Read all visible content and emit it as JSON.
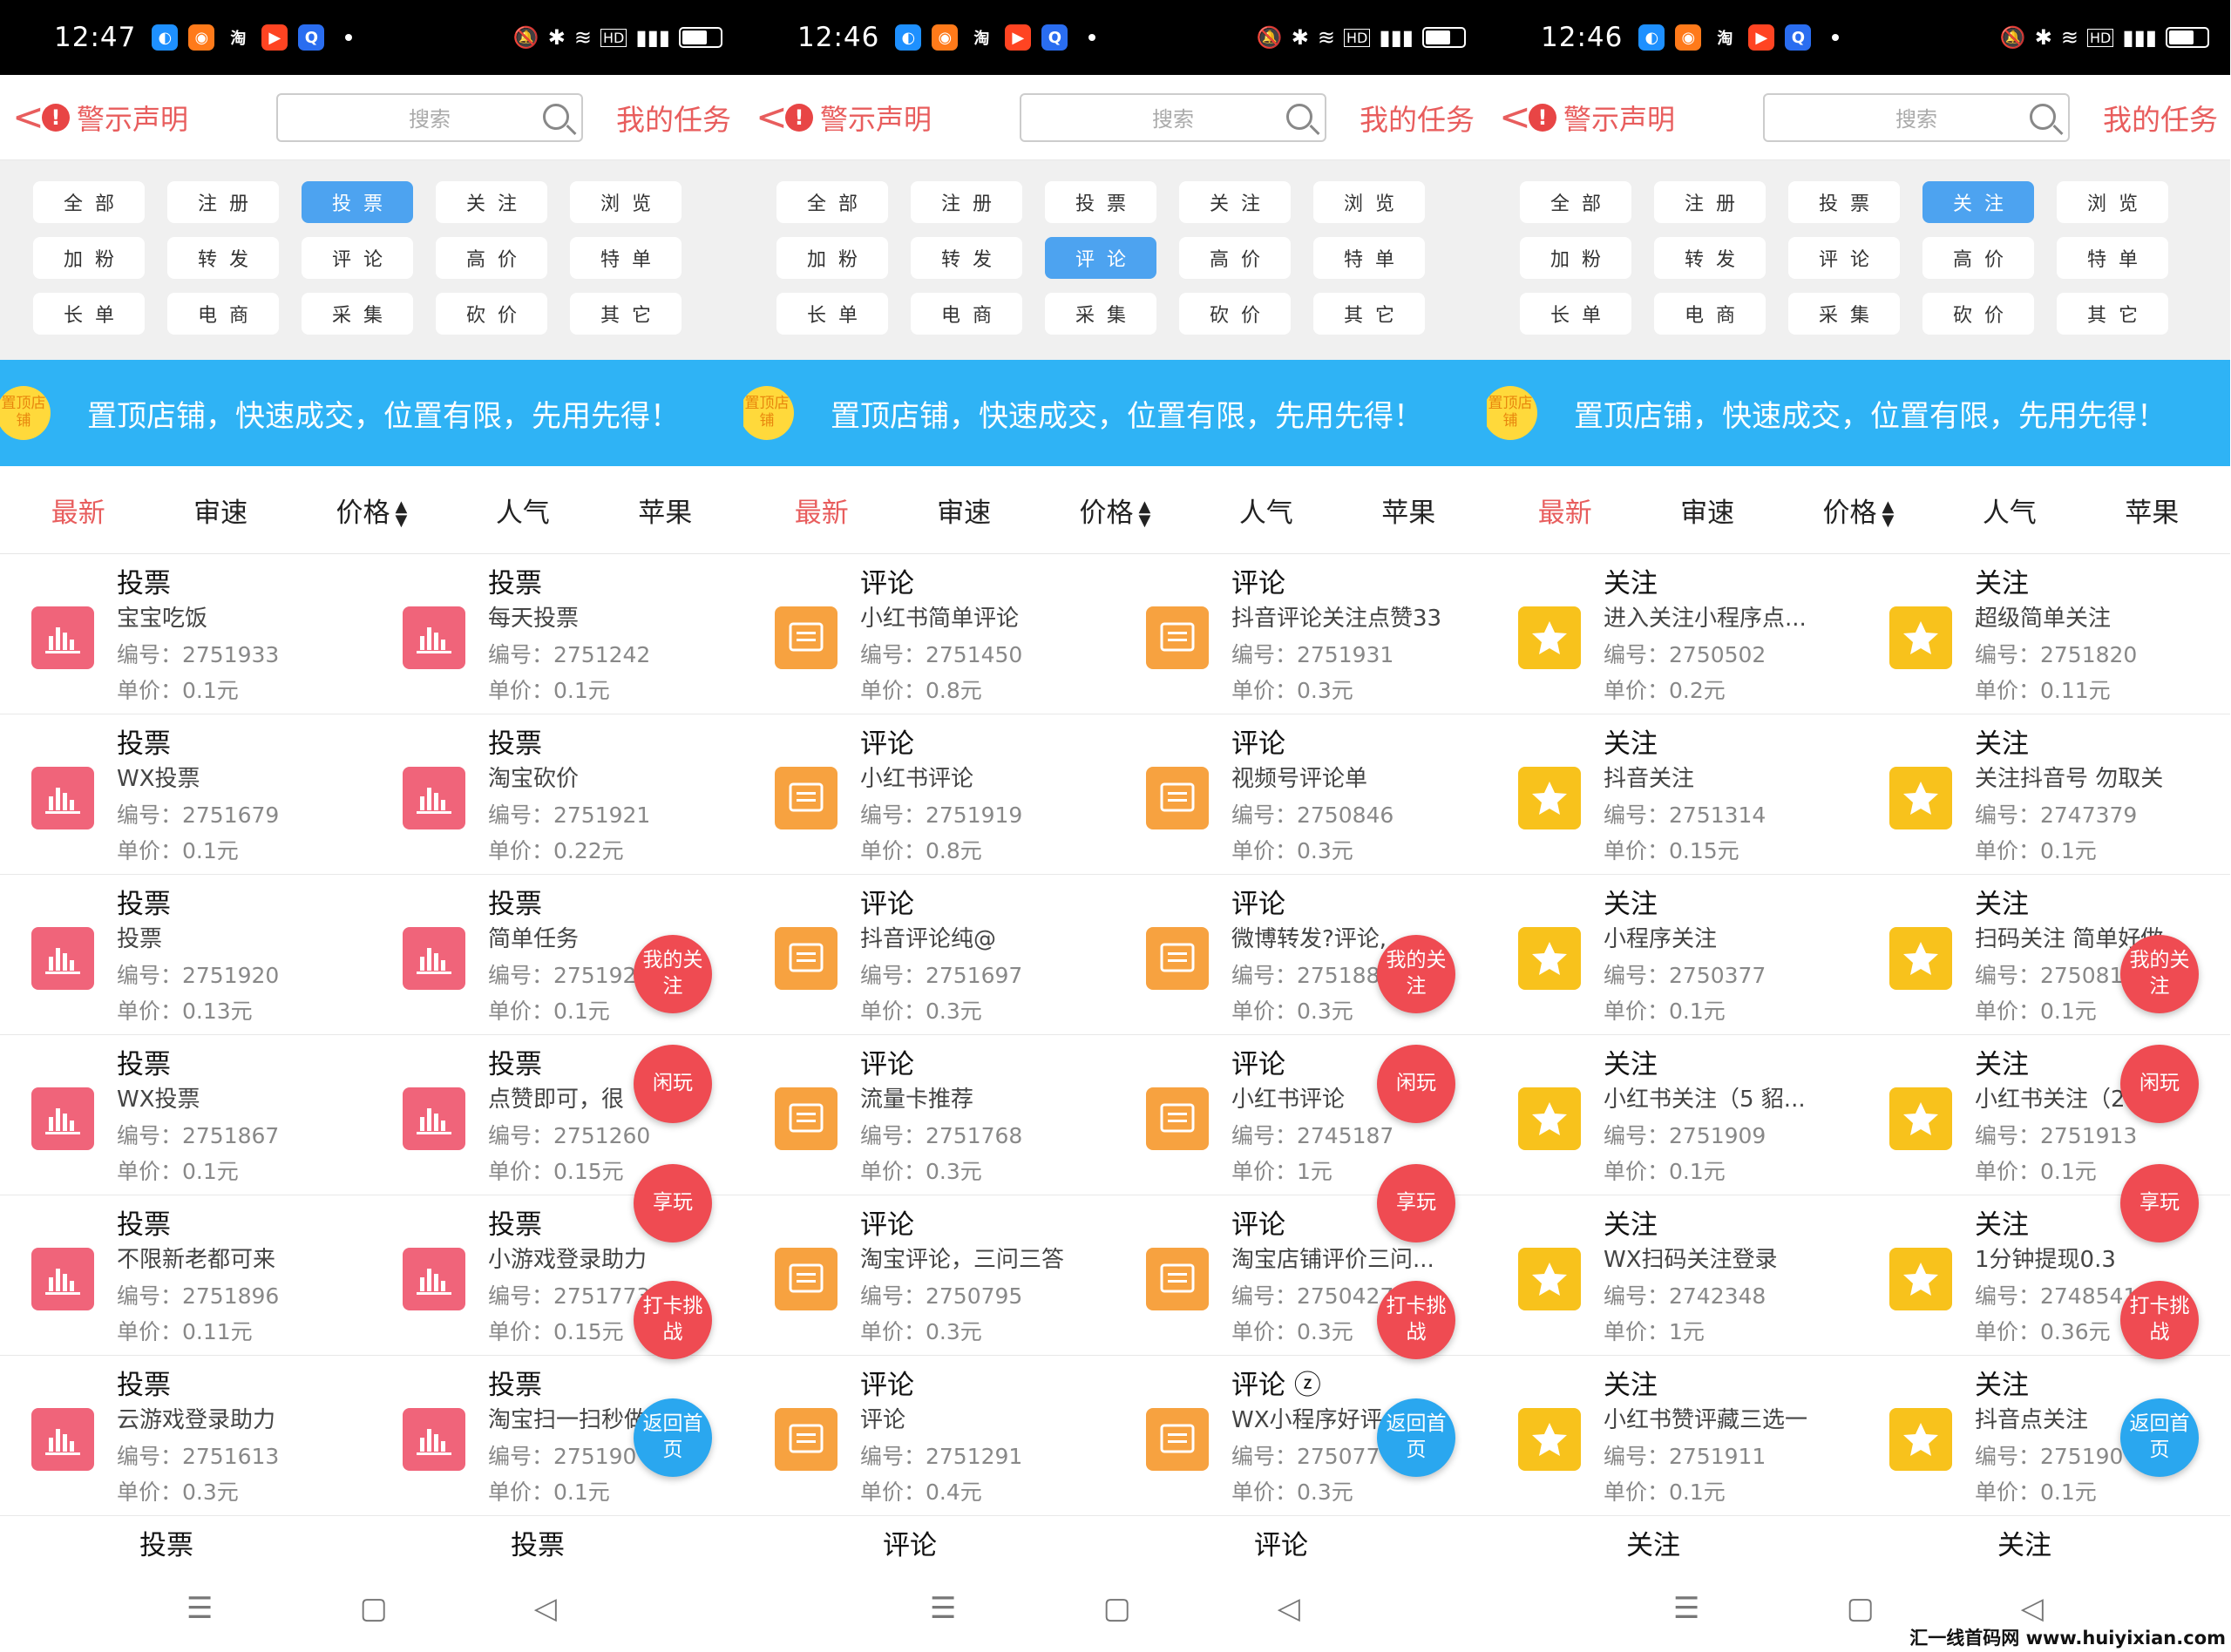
{
  "screens": [
    {
      "time": "12:47",
      "back_label": "<",
      "warn_label": "警示声明",
      "search_placeholder": "搜索",
      "mytask_label": "我的任务",
      "categories": [
        "全部",
        "注册",
        "投票",
        "关注",
        "浏览",
        "加粉",
        "转发",
        "评论",
        "高价",
        "特单",
        "长单",
        "电商",
        "采集",
        "砍价",
        "其它"
      ],
      "active_category": "投票",
      "banner_badge": "置顶店铺",
      "banner_text": "置顶店铺，快速成交，位置有限，先用先得！",
      "sorts": [
        "最新",
        "审速",
        "价格",
        "人气",
        "苹果"
      ],
      "icon_type": "vote",
      "rows": [
        [
          {
            "type": "投票",
            "name": "宝宝吃饭",
            "code": "编号：2751933",
            "price": "单价：0.1元"
          },
          {
            "type": "投票",
            "name": "每天投票",
            "code": "编号：2751242",
            "price": "单价：0.1元"
          }
        ],
        [
          {
            "type": "投票",
            "name": "WX投票",
            "code": "编号：2751679",
            "price": "单价：0.1元"
          },
          {
            "type": "投票",
            "name": "淘宝砍价",
            "code": "编号：2751921",
            "price": "单价：0.22元"
          }
        ],
        [
          {
            "type": "投票",
            "name": "投票",
            "code": "编号：2751920",
            "price": "单价：0.13元"
          },
          {
            "type": "投票",
            "name": "简单任务",
            "code": "编号：275192",
            "price": "单价：0.1元"
          }
        ],
        [
          {
            "type": "投票",
            "name": "WX投票",
            "code": "编号：2751867",
            "price": "单价：0.1元"
          },
          {
            "type": "投票",
            "name": "点赞即可，很",
            "code": "编号：2751260",
            "price": "单价：0.15元"
          }
        ],
        [
          {
            "type": "投票",
            "name": "不限新老都可来",
            "code": "编号：2751896",
            "price": "单价：0.11元"
          },
          {
            "type": "投票",
            "name": "小游戏登录助力",
            "code": "编号：2751773",
            "price": "单价：0.15元"
          }
        ],
        [
          {
            "type": "投票",
            "name": "云游戏登录助力",
            "code": "编号：2751613",
            "price": "单价：0.3元"
          },
          {
            "type": "投票",
            "name": "淘宝扫一扫秒做",
            "code": "编号：275190",
            "price": "单价：0.1元"
          }
        ]
      ],
      "last_row": [
        "投票",
        "投票"
      ]
    },
    {
      "time": "12:46",
      "back_label": "<",
      "warn_label": "警示声明",
      "search_placeholder": "搜索",
      "mytask_label": "我的任务",
      "categories": [
        "全部",
        "注册",
        "投票",
        "关注",
        "浏览",
        "加粉",
        "转发",
        "评论",
        "高价",
        "特单",
        "长单",
        "电商",
        "采集",
        "砍价",
        "其它"
      ],
      "active_category": "评论",
      "banner_badge": "置顶店铺",
      "banner_text": "置顶店铺，快速成交，位置有限，先用先得！",
      "sorts": [
        "最新",
        "审速",
        "价格",
        "人气",
        "苹果"
      ],
      "icon_type": "comment",
      "rows": [
        [
          {
            "type": "评论",
            "name": "小红书简单评论",
            "code": "编号：2751450",
            "price": "单价：0.8元"
          },
          {
            "type": "评论",
            "name": "抖音评论关注点赞33",
            "code": "编号：2751931",
            "price": "单价：0.3元"
          }
        ],
        [
          {
            "type": "评论",
            "name": "小红书评论",
            "code": "编号：2751919",
            "price": "单价：0.8元"
          },
          {
            "type": "评论",
            "name": "视频号评论单",
            "code": "编号：2750846",
            "price": "单价：0.3元"
          }
        ],
        [
          {
            "type": "评论",
            "name": "抖音评论纯@",
            "code": "编号：2751697",
            "price": "单价：0.3元"
          },
          {
            "type": "评论",
            "name": "微博转发?评论,",
            "code": "编号：275188",
            "price": "单价：0.3元"
          }
        ],
        [
          {
            "type": "评论",
            "name": "流量卡推荐",
            "code": "编号：2751768",
            "price": "单价：0.3元"
          },
          {
            "type": "评论",
            "name": "小红书评论",
            "code": "编号：2745187",
            "price": "单价：1元"
          }
        ],
        [
          {
            "type": "评论",
            "name": "淘宝评论，三问三答",
            "code": "编号：2750795",
            "price": "单价：0.3元"
          },
          {
            "type": "评论",
            "name": "淘宝店铺评价三问...",
            "code": "编号：2750427",
            "price": "单价：0.3元"
          }
        ],
        [
          {
            "type": "评论",
            "name": "评论",
            "code": "编号：2751291",
            "price": "单价：0.4元"
          },
          {
            "type": "评论 ⓩ",
            "name": "WX小程序好评",
            "code": "编号：275077",
            "price": "单价：0.3元"
          }
        ]
      ],
      "last_row": [
        "评论",
        "评论"
      ]
    },
    {
      "time": "12:46",
      "back_label": "<",
      "warn_label": "警示声明",
      "search_placeholder": "搜索",
      "mytask_label": "我的任务",
      "categories": [
        "全部",
        "注册",
        "投票",
        "关注",
        "浏览",
        "加粉",
        "转发",
        "评论",
        "高价",
        "特单",
        "长单",
        "电商",
        "采集",
        "砍价",
        "其它"
      ],
      "active_category": "关注",
      "banner_badge": "置顶店铺",
      "banner_text": "置顶店铺，快速成交，位置有限，先用先得！",
      "sorts": [
        "最新",
        "审速",
        "价格",
        "人气",
        "苹果"
      ],
      "icon_type": "follow",
      "rows": [
        [
          {
            "type": "关注",
            "name": "进入关注小程序点...",
            "code": "编号：2750502",
            "price": "单价：0.2元"
          },
          {
            "type": "关注",
            "name": "超级简单关注",
            "code": "编号：2751820",
            "price": "单价：0.11元"
          }
        ],
        [
          {
            "type": "关注",
            "name": "抖音关注",
            "code": "编号：2751314",
            "price": "单价：0.15元"
          },
          {
            "type": "关注",
            "name": "关注抖音号 勿取关",
            "code": "编号：2747379",
            "price": "单价：0.1元"
          }
        ],
        [
          {
            "type": "关注",
            "name": "小程序关注",
            "code": "编号：2750377",
            "price": "单价：0.1元"
          },
          {
            "type": "关注",
            "name": "扫码关注 简单好做",
            "code": "编号：275081",
            "price": "单价：0.1元"
          }
        ],
        [
          {
            "type": "关注",
            "name": "小红书关注（5 貂...",
            "code": "编号：2751909",
            "price": "单价：0.1元"
          },
          {
            "type": "关注",
            "name": "小红书关注（2",
            "code": "编号：2751913",
            "price": "单价：0.1元"
          }
        ],
        [
          {
            "type": "关注",
            "name": "WX扫码关注登录",
            "code": "编号：2742348",
            "price": "单价：1元"
          },
          {
            "type": "关注",
            "name": "1分钟提现0.3",
            "code": "编号：2748541",
            "price": "单价：0.36元"
          }
        ],
        [
          {
            "type": "关注",
            "name": "小红书赞评藏三选一",
            "code": "编号：2751911",
            "price": "单价：0.1元"
          },
          {
            "type": "关注",
            "name": "抖音点关注",
            "code": "编号：275190",
            "price": "单价：0.1元"
          }
        ]
      ],
      "last_row": [
        "关注",
        "关注"
      ]
    }
  ],
  "fabs": {
    "my_follow": "我的关注",
    "play": "闲玩",
    "enjoy": "享玩",
    "checkin": "打卡挑战",
    "home": "返回首页"
  },
  "watermark": "汇一线首码网 www.huiyixian.com"
}
